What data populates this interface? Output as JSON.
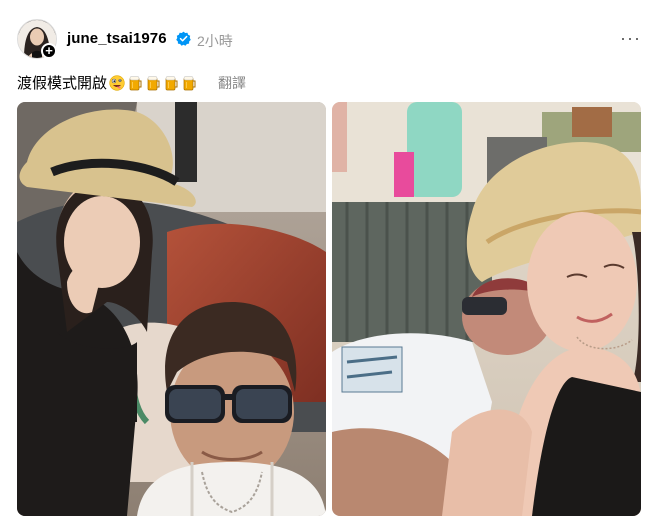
{
  "post": {
    "username": "june_tsai1976",
    "timestamp": "2小時",
    "caption": "渡假模式開啟",
    "caption_emojis": [
      "crazy-face-emoji",
      "beer-mug-emoji",
      "beer-mug-emoji",
      "beer-mug-emoji",
      "beer-mug-emoji"
    ],
    "translate_label": "翻譯",
    "more_label": "···"
  },
  "icons": {
    "verified": "verified-badge-icon",
    "follow": "plus-icon",
    "more": "more-options-icon"
  },
  "colors": {
    "verified_blue": "#0095f6",
    "muted_text": "#999999"
  }
}
